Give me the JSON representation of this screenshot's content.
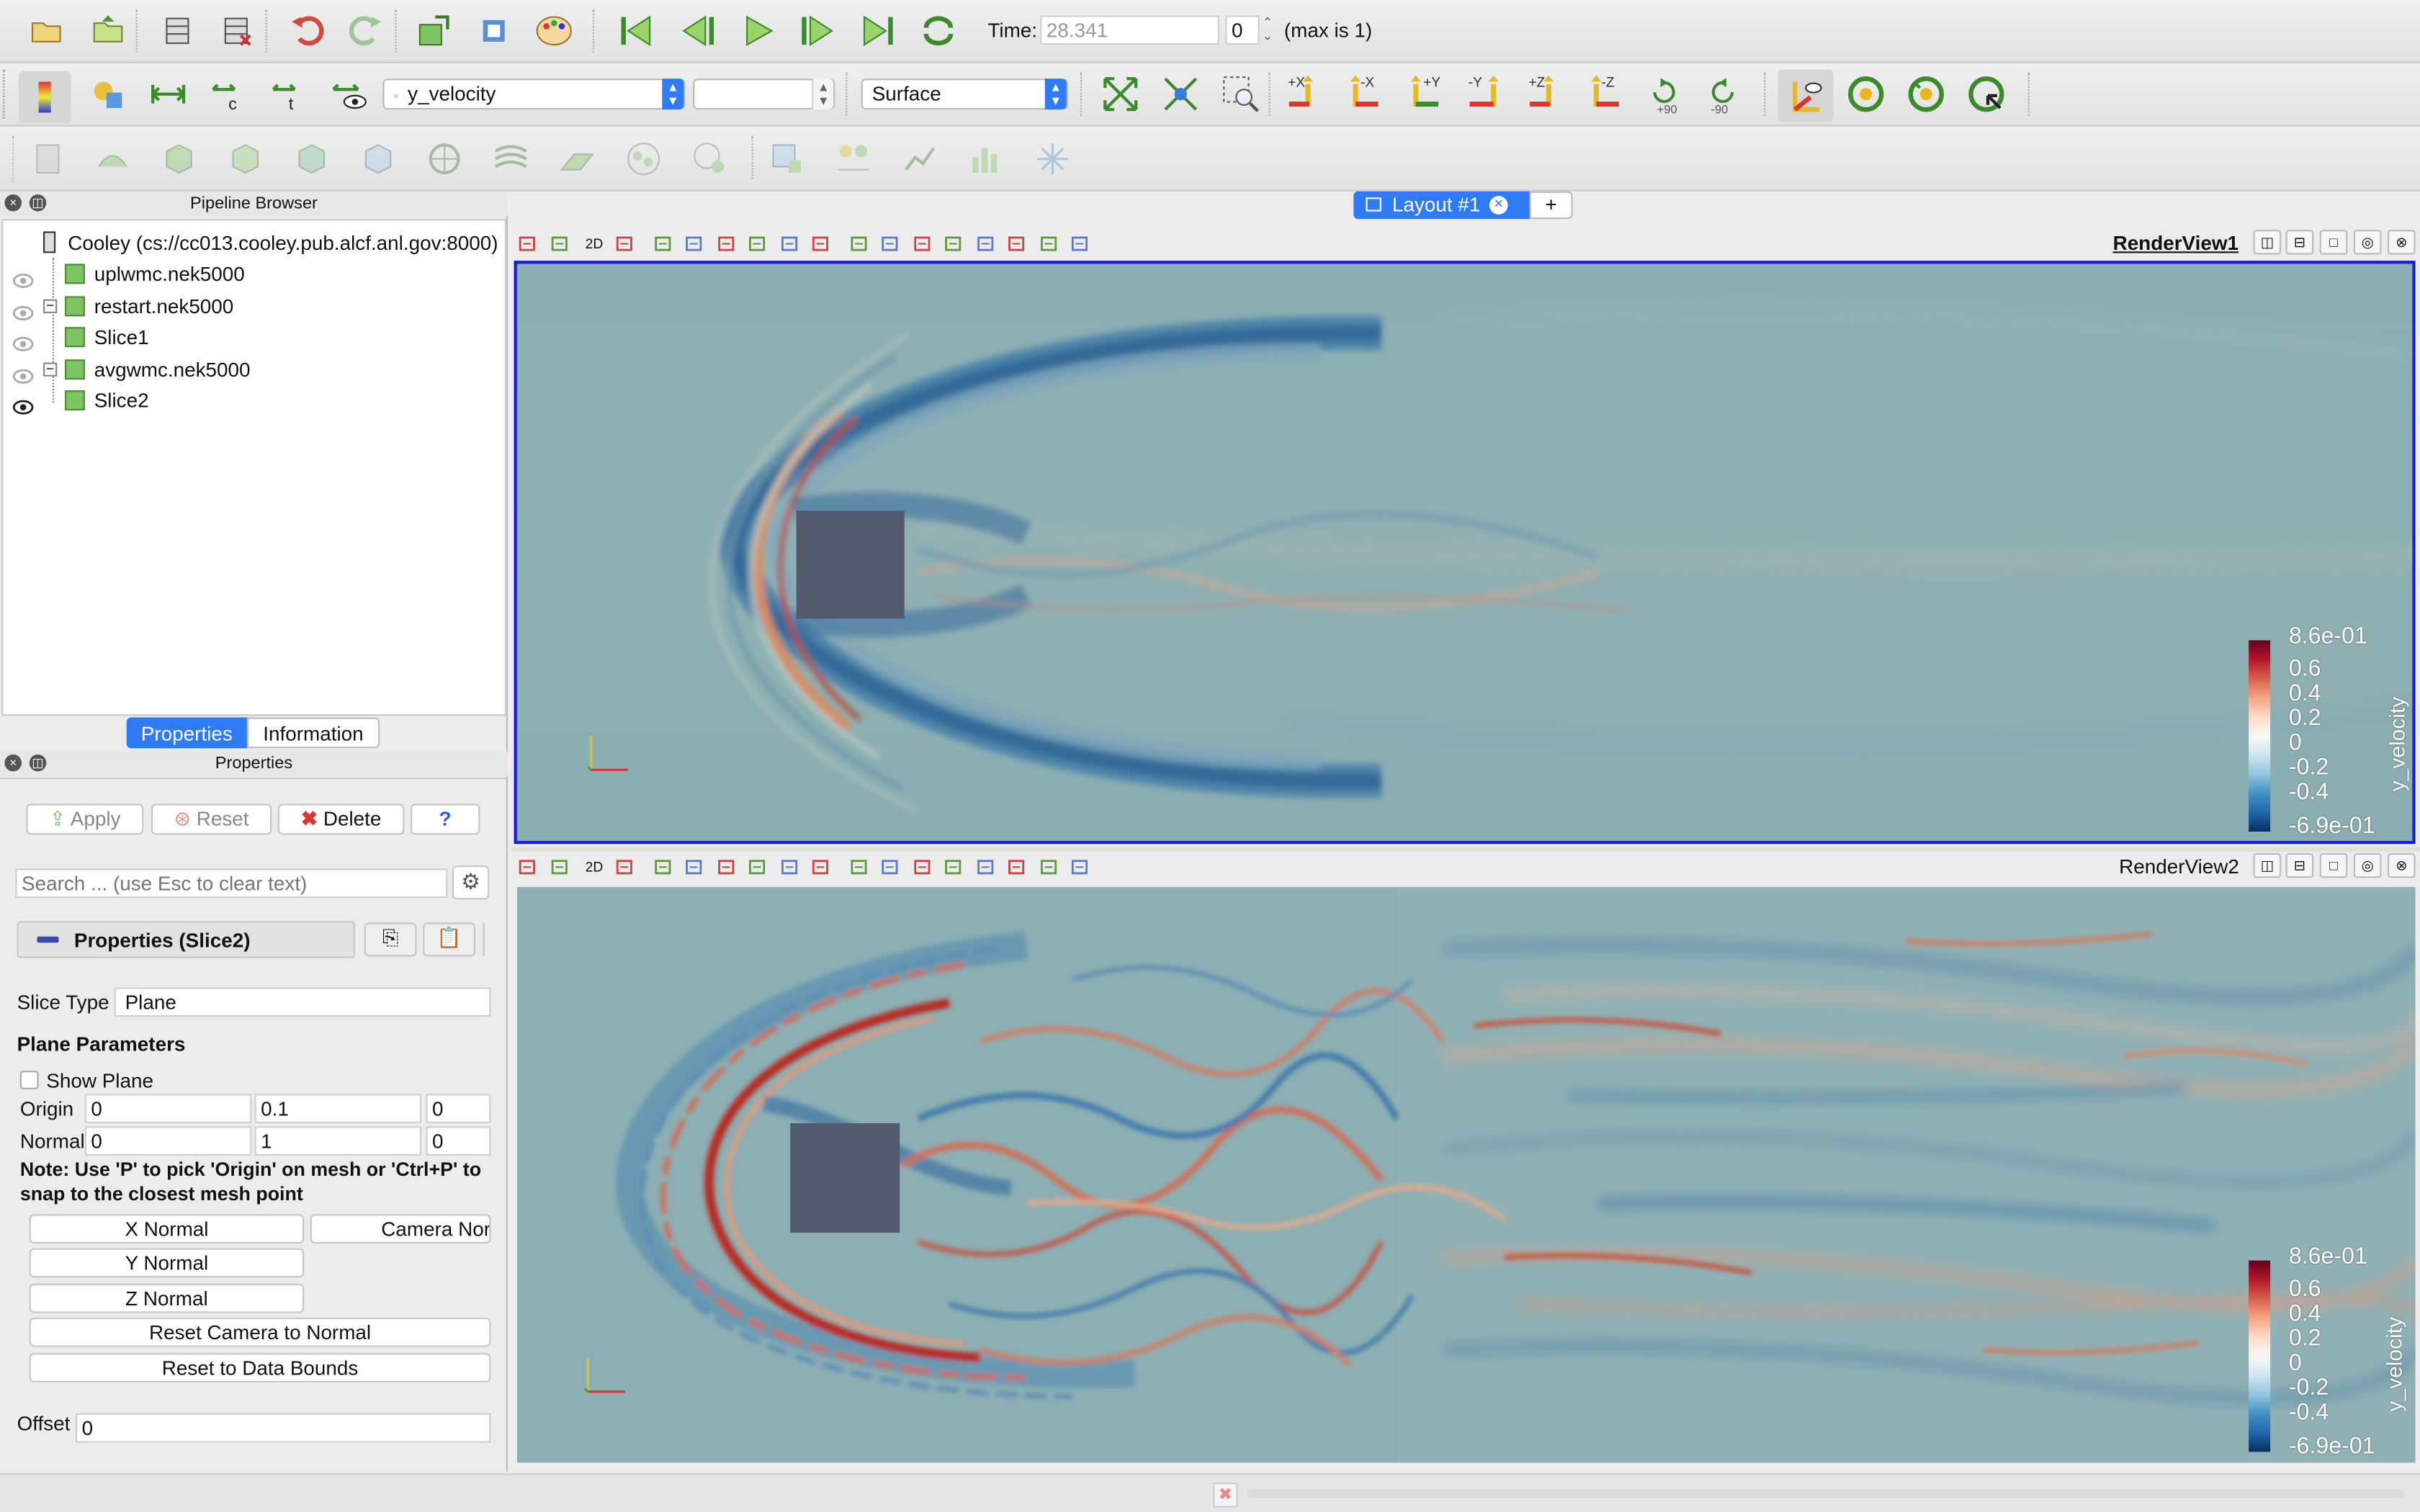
{
  "toolbar_top": {
    "time_label": "Time:",
    "time_value": "28.341",
    "time_index": "0",
    "time_max": "(max is 1)"
  },
  "toolbar_second": {
    "color_array": "y_velocity",
    "component": "",
    "representation": "Surface",
    "camera_labels": {
      "px": "+X",
      "mx": "-X",
      "py": "+Y",
      "my": "-Y",
      "pz": "+Z",
      "mz": "-Z",
      "rot_plus": "+90",
      "rot_minus": "-90"
    }
  },
  "pipeline": {
    "title": "Pipeline Browser",
    "server": "Cooley (cs://cc013.cooley.pub.alcf.anl.gov:8000)",
    "items": [
      {
        "label": "uplwmc.nek5000",
        "visible": false
      },
      {
        "label": "restart.nek5000",
        "visible": false
      },
      {
        "label": "Slice1",
        "visible": false
      },
      {
        "label": "avgwmc.nek5000",
        "visible": false
      },
      {
        "label": "Slice2",
        "visible": true
      }
    ]
  },
  "tabs": {
    "properties": "Properties",
    "information": "Information"
  },
  "properties": {
    "title": "Properties",
    "apply": "Apply",
    "reset": "Reset",
    "delete": "Delete",
    "help": "?",
    "search_placeholder": "Search ... (use Esc to clear text)",
    "section_title": "Properties (Slice2)",
    "slice_type_label": "Slice Type",
    "slice_type_value": "Plane",
    "plane_params": "Plane Parameters",
    "show_plane": "Show Plane",
    "origin_label": "Origin",
    "origin": [
      "0",
      "0.1",
      "0"
    ],
    "normal_label": "Normal",
    "normal": [
      "0",
      "1",
      "0"
    ],
    "note": "Note: Use 'P' to pick 'Origin' on mesh or 'Ctrl+P' to snap to the closest mesh point",
    "x_normal": "X Normal",
    "camera_normal": "Camera Normal",
    "y_normal": "Y Normal",
    "z_normal": "Z Normal",
    "reset_camera": "Reset Camera to Normal",
    "reset_bounds": "Reset to Data Bounds",
    "offset_label": "Offset",
    "offset_value": "0"
  },
  "layout": {
    "tab_label": "Layout #1",
    "add_tab": "+"
  },
  "views": [
    {
      "name": "RenderView1",
      "mini_2d": "2D",
      "colorbar": {
        "title": "y_velocity",
        "max": "8.6e-01",
        "min": "-6.9e-01",
        "ticks": [
          "0.6",
          "0.4",
          "0.2",
          "0",
          "-0.2",
          "-0.4"
        ]
      }
    },
    {
      "name": "RenderView2",
      "mini_2d": "2D",
      "colorbar": {
        "title": "y_velocity",
        "max": "8.6e-01",
        "min": "-6.9e-01",
        "ticks": [
          "0.6",
          "0.4",
          "0.2",
          "0",
          "-0.2",
          "-0.4"
        ]
      }
    }
  ],
  "colors": {
    "accent": "#2f7bf6",
    "selection_border": "#1b1bd6",
    "flow_background": "#8fb0b3",
    "obstacle": "#545a6e"
  }
}
